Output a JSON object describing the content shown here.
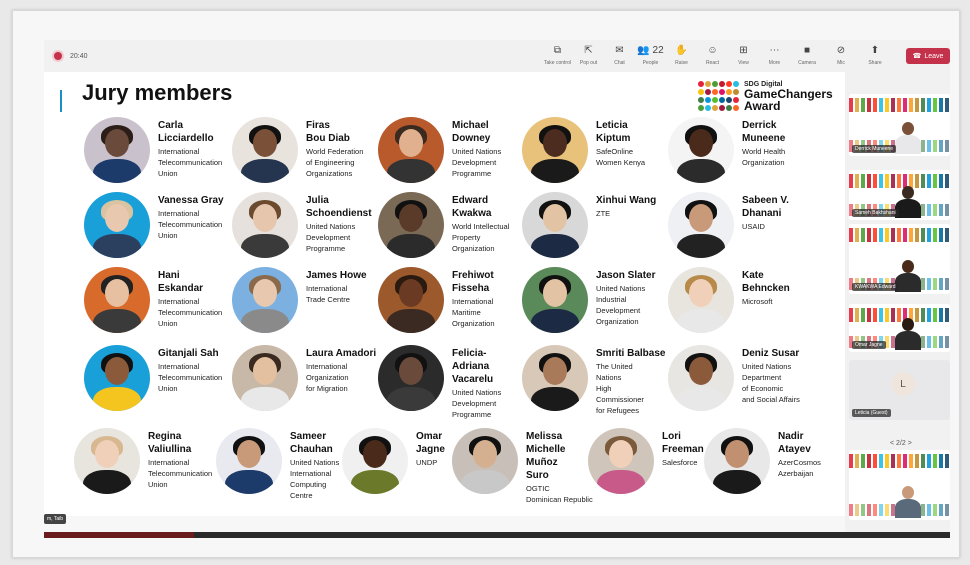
{
  "meeting": {
    "timer": "20:40",
    "tools": [
      {
        "icon": "⧉",
        "label": "Take control"
      },
      {
        "icon": "⇱",
        "label": "Pop out"
      },
      {
        "icon": "✉",
        "label": "Chat"
      },
      {
        "icon": "👥 22",
        "label": "People"
      },
      {
        "icon": "✋",
        "label": "Raise"
      },
      {
        "icon": "☺",
        "label": "React"
      },
      {
        "icon": "⊞",
        "label": "View"
      },
      {
        "icon": "⋯",
        "label": "More"
      },
      {
        "icon": "■",
        "label": "Camera"
      },
      {
        "icon": "⊘",
        "label": "Mic"
      },
      {
        "icon": "⬆",
        "label": "Share"
      }
    ],
    "leave_label": "Leave",
    "presenter_label": "m, Taib",
    "gallery_pager": "< 2/2 >"
  },
  "slide": {
    "title": "Jury members",
    "logo_sub": "SDG Digital",
    "logo_line1": "GameChangers",
    "logo_line2": "Award"
  },
  "members": [
    {
      "name": "Carla\nLicciardello",
      "org": "International\nTelecommunication\nUnion"
    },
    {
      "name": "Firas\nBou Diab",
      "org": "World Federation\nof Engineering\nOrganizations"
    },
    {
      "name": "Michael\nDowney",
      "org": "United Nations\nDevelopment\nProgramme"
    },
    {
      "name": "Leticia\nKiptum",
      "org": "SafeOnline\nWomen Kenya"
    },
    {
      "name": "Derrick\nMuneene",
      "org": "World Health\nOrganization"
    },
    {
      "name": "Vanessa Gray",
      "org": "International\nTelecommunication\nUnion"
    },
    {
      "name": "Julia\nSchoendienst",
      "org": "United Nations\nDevelopment\nProgramme"
    },
    {
      "name": "Edward\nKwakwa",
      "org": "World Intellectual\nProperty\nOrganization"
    },
    {
      "name": "Xinhui Wang",
      "org": "ZTE"
    },
    {
      "name": "Sabeen V.\nDhanani",
      "org": "USAID"
    },
    {
      "name": "Hani\nEskandar",
      "org": "International\nTelecommunication\nUnion"
    },
    {
      "name": "James Howe",
      "org": "International\nTrade Centre"
    },
    {
      "name": "Frehiwot\nFisseha",
      "org": "International\nMaritime\nOrganization"
    },
    {
      "name": "Jason Slater",
      "org": "United Nations\nIndustrial\nDevelopment\nOrganization"
    },
    {
      "name": "Kate\nBehncken",
      "org": "Microsoft"
    },
    {
      "name": "Gitanjali Sah",
      "org": "International\nTelecommunication\nUnion"
    },
    {
      "name": "Laura Amadori",
      "org": "International\nOrganization\nfor Migration"
    },
    {
      "name": "Felicia-\nAdriana\nVacarelu",
      "org": "United Nations\nDevelopment\nProgramme"
    },
    {
      "name": "Smriti Balbase",
      "org": "The United\nNations\nHigh\nCommissioner\nfor Refugees"
    },
    {
      "name": "Deniz Susar",
      "org": "United Nations\nDepartment\nof Economic\nand Social Affairs"
    },
    {
      "name": "Regina\nValiullina",
      "org": "International\nTelecommunication\nUnion"
    },
    {
      "name": "Sameer\nChauhan",
      "org": "United Nations\nInternational\nComputing\nCentre"
    },
    {
      "name": "Omar\nJagne",
      "org": "UNDP"
    },
    {
      "name": "Melissa\nMichelle\nMuñoz\nSuro",
      "org": "OGTIC\nDominican Republic"
    },
    {
      "name": "Lori\nFreeman",
      "org": "Salesforce"
    },
    {
      "name": "Nadir\nAtayev",
      "org": "AzerCosmos\nAzerbaijan"
    }
  ],
  "gallery": [
    {
      "label": "Derrick Muneene"
    },
    {
      "label": "Sameh Bakhshani"
    },
    {
      "label": "KWAKWA Edward"
    },
    {
      "label": "Omar Jagne"
    },
    {
      "label": "Leticia (Guest)",
      "initial": "L"
    },
    {
      "label": ""
    }
  ]
}
